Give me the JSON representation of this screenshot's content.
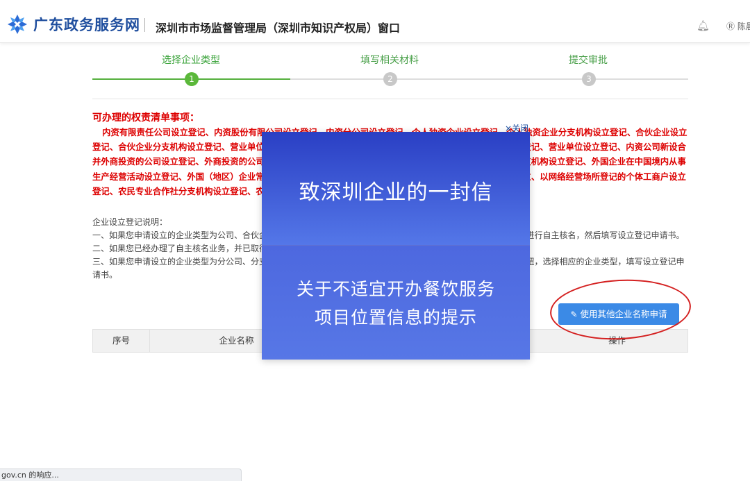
{
  "header": {
    "site_name": "广东政务服务网",
    "dept_title": "深圳市市场监督管理局（深圳市知识产权局）窗口",
    "user_name": "陈晨",
    "icons": [
      "logo-icon",
      "bell-icon",
      "user-icon"
    ]
  },
  "steps": [
    {
      "label": "选择企业类型",
      "num": "1",
      "active": true
    },
    {
      "label": "填写相关材料",
      "num": "2",
      "active": false
    },
    {
      "label": "提交审批",
      "num": "3",
      "active": false
    }
  ],
  "rights": {
    "title": "可办理的权责清单事项：",
    "body": "内资有限责任公司设立登记、内资股份有限公司设立登记、内资分公司设立登记、个人独资企业设立登记、个人独资企业分支机构设立登记、合伙企业设立登记、合伙企业分支机构设立登记、营业单位设立登记、内资公司新设合并非法人设立登记、非法人分支机构设立登记、营业单位设立登记、内资公司新设合并外商投资的公司设立登记、外商投资的公司分公司设立登记、外商投资合伙企业设立登记、外商投资合伙企业分支机构设立登记、外国企业在中国境内从事生产经营活动设立登记、外国（地区）企业常驻代表机构设立登记、个体工商户设立、港澳居民申办个体工商户设立、以网络经营场所登记的个体工商户设立登记、农民专业合作社分支机构设立登记、农民专业合作社设立登记"
  },
  "explain": {
    "title": "企业设立登记说明：",
    "p1": "一、如果您申请设立的企业类型为公司、合伙企业等，请点击“使用其他企业名称申请”按钮，选择相应的企业类型，先进行自主核名，然后填写设立登记申请书。",
    "p2": "二、如果您已经办理了自主核名业务，并已取得企业名称的，请直接填写设立登记申请书。",
    "p3": "三、如果您申请设立的企业类型为分公司、分支机构或者经营范围需要前置许可的，请点击“使用其他企业名称申请”按钮，选择相应的企业类型，填写设立登记申请书。"
  },
  "close_label": "×关闭",
  "popup": {
    "title": "致深圳企业的一封信",
    "subtitle_line1": "关于不适宜开办餐饮服务",
    "subtitle_line2": "项目位置信息的提示"
  },
  "button": {
    "label": "使用其他企业名称申请",
    "icon": "edit-icon"
  },
  "table": {
    "columns": [
      "序号",
      "企业名称",
      "操作"
    ]
  },
  "status_bar": "gov.cn 的响应..."
}
